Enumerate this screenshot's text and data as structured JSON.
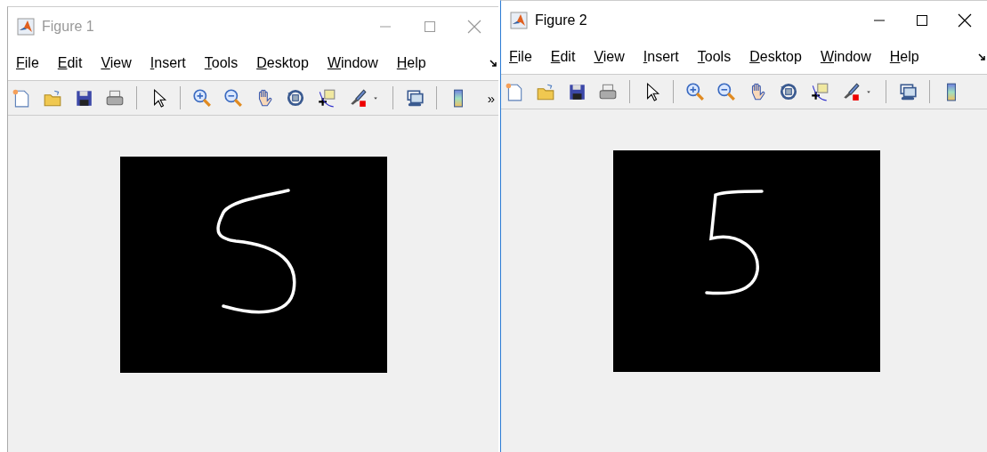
{
  "windows": [
    {
      "title": "Figure 1",
      "active": false,
      "menu": [
        "File",
        "Edit",
        "View",
        "Insert",
        "Tools",
        "Desktop",
        "Window",
        "Help"
      ],
      "toolbar_overflow": "»"
    },
    {
      "title": "Figure 2",
      "active": true,
      "menu": [
        "File",
        "Edit",
        "View",
        "Insert",
        "Tools",
        "Desktop",
        "Window",
        "Help"
      ]
    }
  ]
}
